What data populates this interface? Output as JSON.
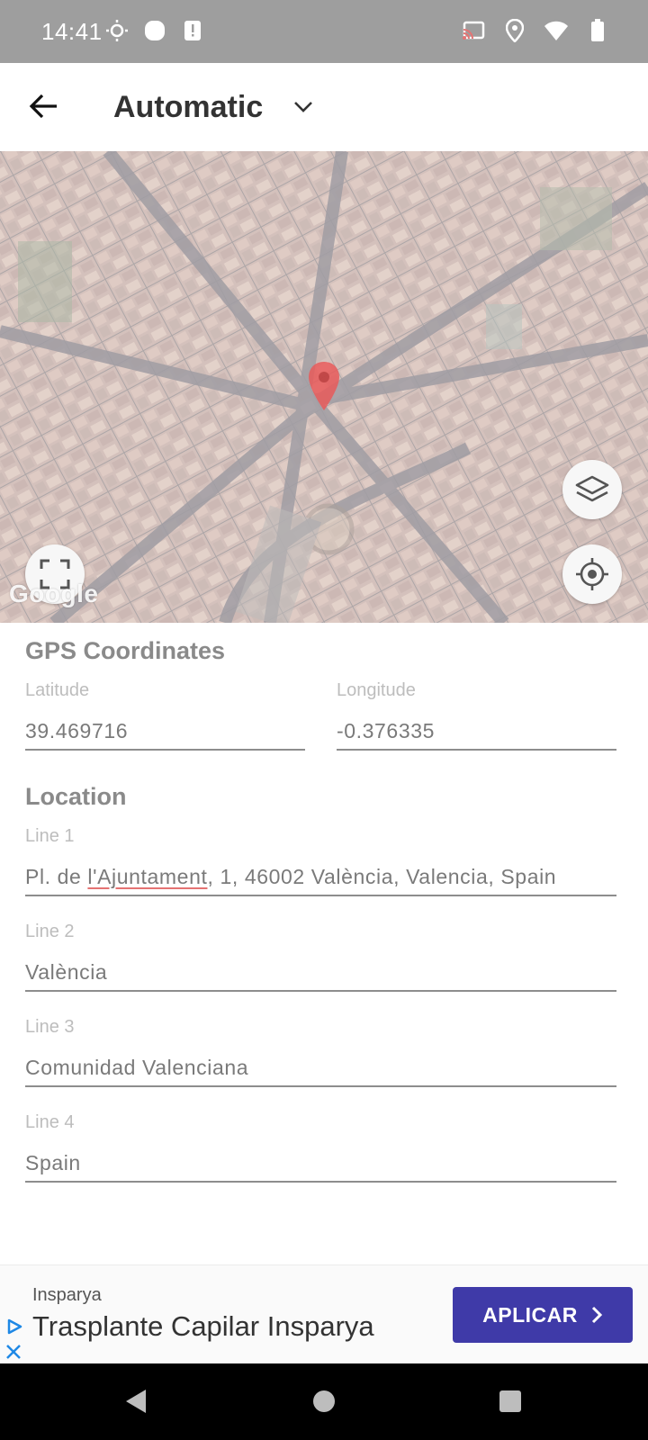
{
  "status_bar": {
    "time": "14:41",
    "left_icons": [
      "brightness-icon",
      "circle-notification-icon",
      "alert-notification-icon"
    ],
    "right_icons": [
      "cast-icon",
      "location-icon",
      "wifi-icon",
      "battery-icon"
    ]
  },
  "app_bar": {
    "back_icon": "arrow-left-icon",
    "mode_label": "Automatic",
    "dropdown_icon": "chevron-down-icon"
  },
  "map": {
    "attribution": "Google",
    "buttons": [
      "layers-icon",
      "my-location-icon",
      "fullscreen-icon"
    ],
    "marker_color": "#e85b5b"
  },
  "gps": {
    "title": "GPS Coordinates",
    "latitude_label": "Latitude",
    "latitude_value": "39.469716",
    "longitude_label": "Longitude",
    "longitude_value": "-0.376335"
  },
  "location": {
    "title": "Location",
    "line1_label": "Line 1",
    "line1_prefix": "Pl. de ",
    "line1_marked": "l'Ajuntament",
    "line1_suffix": ", 1, 46002 València, Valencia, Spain",
    "line2_label": "Line 2",
    "line2_value": "València",
    "line3_label": "Line 3",
    "line3_value": "Comunidad Valenciana",
    "line4_label": "Line 4",
    "line4_value": "Spain"
  },
  "ad": {
    "advertiser": "Insparya",
    "headline": "Trasplante Capilar Insparya",
    "cta_label": "APLICAR",
    "cta_color": "#3f3aa8"
  },
  "nav_bar": {
    "buttons": [
      "back-triangle-icon",
      "home-circle-icon",
      "recents-square-icon"
    ]
  }
}
